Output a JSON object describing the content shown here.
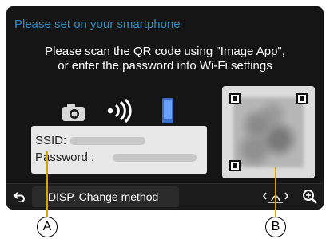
{
  "screen": {
    "title": "Please set on your smartphone",
    "message": [
      "Please scan the QR code using \"Image App\",",
      "or enter the password into Wi-Fi settings"
    ],
    "ssid_label": "SSID:",
    "password_label": "Password :",
    "bottom_bar": {
      "disp_label": "DISP. Change method",
      "icons": [
        "back-icon",
        "scroll-icon",
        "zoom-icon"
      ]
    },
    "connection_icons": [
      "camera-icon",
      "wifi-signal-icon",
      "smartphone-icon"
    ]
  },
  "callouts": {
    "a": "A",
    "b": "B"
  },
  "colors": {
    "title": "#2f8fc0",
    "background": "#151515",
    "info_box": "#e8e8e8",
    "callout_line": "#d9a300"
  }
}
